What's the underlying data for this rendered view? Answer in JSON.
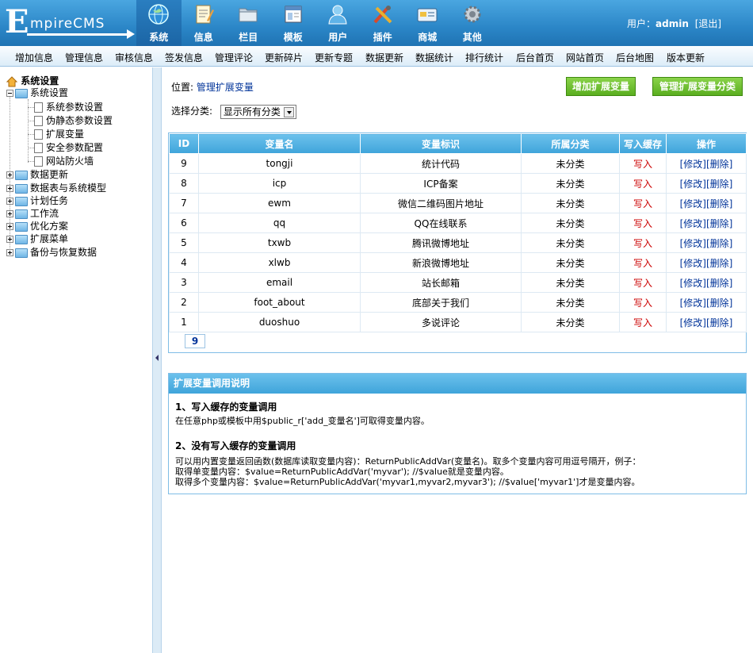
{
  "header": {
    "logo_text": "EmpireCMS",
    "logo_first": "E",
    "logo_rest": "mpireCMS",
    "nav": [
      {
        "label": "系统",
        "icon": "globe-icon"
      },
      {
        "label": "信息",
        "icon": "notepad-icon"
      },
      {
        "label": "栏目",
        "icon": "folder-icon"
      },
      {
        "label": "模板",
        "icon": "window-template-icon"
      },
      {
        "label": "用户",
        "icon": "user-icon"
      },
      {
        "label": "插件",
        "icon": "tools-icon"
      },
      {
        "label": "商城",
        "icon": "card-icon"
      },
      {
        "label": "其他",
        "icon": "gear-icon"
      }
    ],
    "user_label": "用户：",
    "username": "admin",
    "logout": "[退出]"
  },
  "subnav": [
    "增加信息",
    "管理信息",
    "审核信息",
    "签发信息",
    "管理评论",
    "更新碎片",
    "更新专题",
    "数据更新",
    "数据统计",
    "排行统计",
    "后台首页",
    "网站首页",
    "后台地图",
    "版本更新"
  ],
  "sidebar": {
    "root": "系统设置",
    "group_open": "系统设置",
    "children": [
      "系统参数设置",
      "伪静态参数设置",
      "扩展变量",
      "安全参数配置",
      "网站防火墙"
    ],
    "groups": [
      "数据更新",
      "数据表与系统模型",
      "计划任务",
      "工作流",
      "优化方案",
      "扩展菜单",
      "备份与恢复数据"
    ]
  },
  "content": {
    "location_label": "位置:",
    "location_link": "管理扩展变量",
    "btn_add": "增加扩展变量",
    "btn_manage": "管理扩展变量分类",
    "filter_label": "选择分类:",
    "filter_value": "显示所有分类",
    "table": {
      "headers": [
        "ID",
        "变量名",
        "变量标识",
        "所属分类",
        "写入缓存",
        "操作"
      ],
      "rows": [
        {
          "id": "9",
          "name": "tongji",
          "label": "统计代码",
          "cat": "未分类",
          "cache": "写入"
        },
        {
          "id": "8",
          "name": "icp",
          "label": "ICP备案",
          "cat": "未分类",
          "cache": "写入"
        },
        {
          "id": "7",
          "name": "ewm",
          "label": "微信二维码图片地址",
          "cat": "未分类",
          "cache": "写入"
        },
        {
          "id": "6",
          "name": "qq",
          "label": "QQ在线联系",
          "cat": "未分类",
          "cache": "写入"
        },
        {
          "id": "5",
          "name": "txwb",
          "label": "腾讯微博地址",
          "cat": "未分类",
          "cache": "写入"
        },
        {
          "id": "4",
          "name": "xlwb",
          "label": "新浪微博地址",
          "cat": "未分类",
          "cache": "写入"
        },
        {
          "id": "3",
          "name": "email",
          "label": "站长邮箱",
          "cat": "未分类",
          "cache": "写入"
        },
        {
          "id": "2",
          "name": "foot_about",
          "label": "底部关于我们",
          "cat": "未分类",
          "cache": "写入"
        },
        {
          "id": "1",
          "name": "duoshuo",
          "label": "多说评论",
          "cat": "未分类",
          "cache": "写入"
        }
      ],
      "edit": "[修改]",
      "delete": "[删除]",
      "pager": "9"
    },
    "help": {
      "title": "扩展变量调用说明",
      "s1_title": "1、写入缓存的变量调用",
      "s1_text": "在任意php或模板中用$public_r['add_变量名']可取得变量内容。",
      "s2_title": "2、没有写入缓存的变量调用",
      "s2_line1": "可以用内置变量返回函数(数据库读取变量内容)：ReturnPublicAddVar(变量名)。取多个变量内容可用逗号隔开，例子：",
      "s2_line2": "取得单变量内容：$value=ReturnPublicAddVar('myvar'); //$value就是变量内容。",
      "s2_line3": "取得多个变量内容：$value=ReturnPublicAddVar('myvar1,myvar2,myvar3'); //$value['myvar1']才是变量内容。"
    }
  },
  "colors": {
    "header_blue": "#2b86c7",
    "table_header": "#3fa4da",
    "button_green": "#5aae1f",
    "link": "#003399",
    "red": "#cc0000"
  }
}
